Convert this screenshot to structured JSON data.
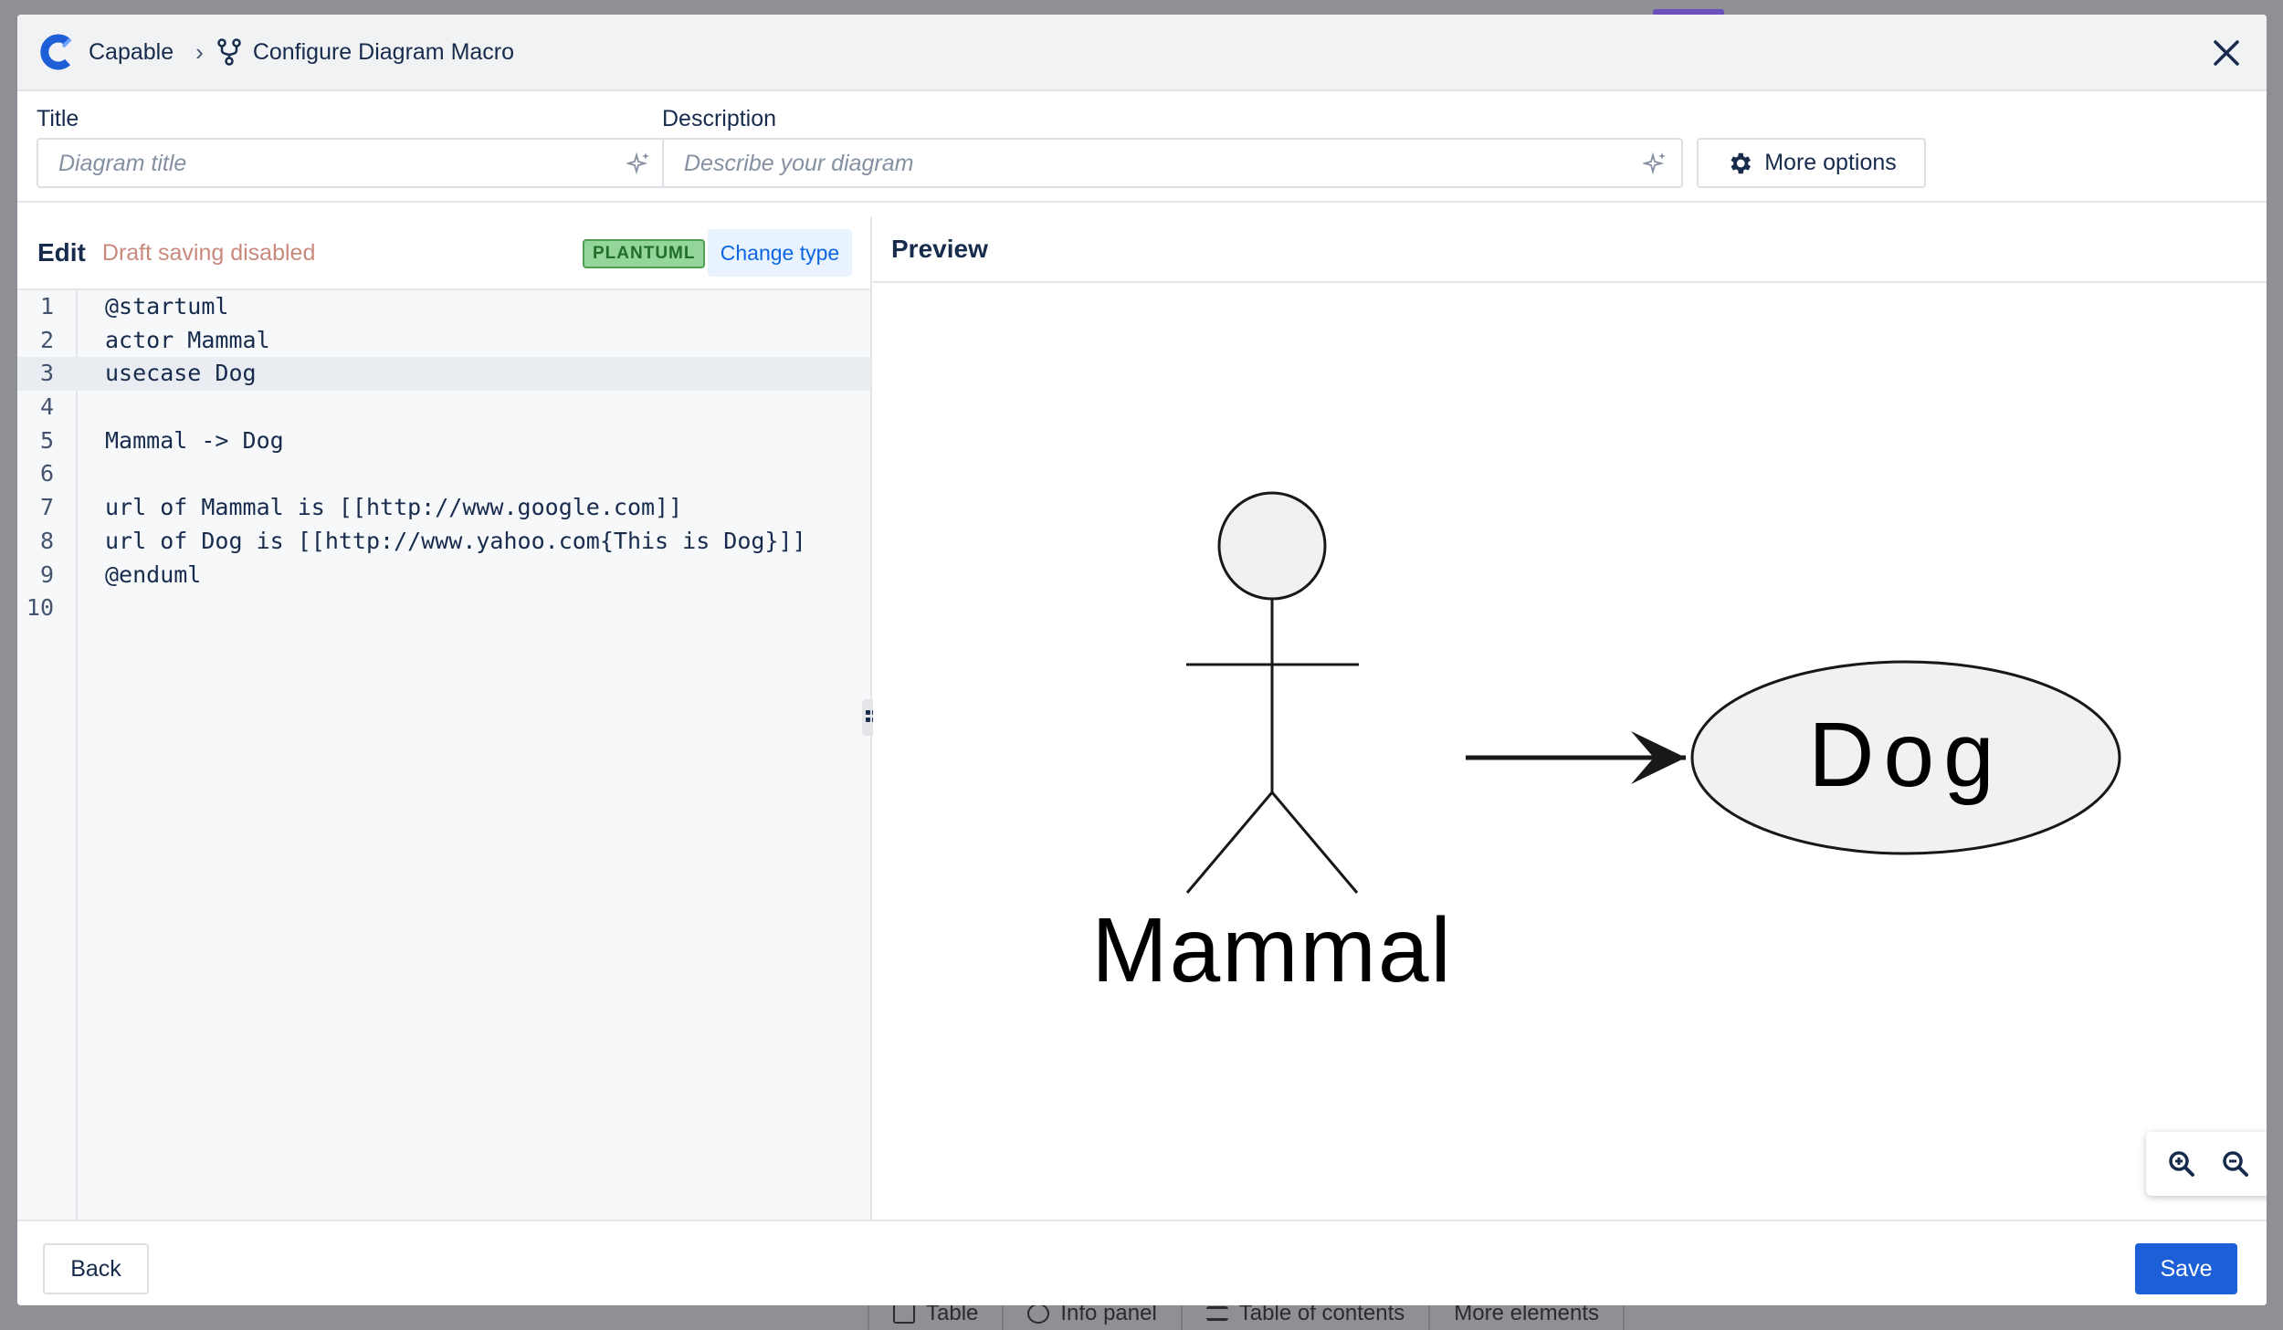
{
  "breadcrumb": {
    "app_name": "Capable",
    "current_page": "Configure Diagram Macro"
  },
  "fields": {
    "title_label": "Title",
    "title_placeholder": "Diagram title",
    "description_label": "Description",
    "description_placeholder": "Describe your diagram",
    "more_options_label": "More options"
  },
  "editor": {
    "heading": "Edit",
    "draft_status": "Draft saving disabled",
    "type_badge": "PLANTUML",
    "change_type_label": "Change type",
    "lines": [
      {
        "n": "1",
        "text": "@startuml"
      },
      {
        "n": "2",
        "text": "actor Mammal"
      },
      {
        "n": "3",
        "text": "usecase Dog"
      },
      {
        "n": "4",
        "text": ""
      },
      {
        "n": "5",
        "text": "Mammal -> Dog"
      },
      {
        "n": "6",
        "text": ""
      },
      {
        "n": "7",
        "text": "url of Mammal is [[http://www.google.com]]"
      },
      {
        "n": "8",
        "text": "url of Dog is [[http://www.yahoo.com{This is Dog}]]"
      },
      {
        "n": "9",
        "text": "@enduml"
      },
      {
        "n": "10",
        "text": ""
      }
    ],
    "active_line": 3
  },
  "preview": {
    "heading": "Preview",
    "actor_label": "Mammal",
    "usecase_label": "Dog"
  },
  "footer": {
    "back_label": "Back",
    "save_label": "Save"
  },
  "background": {
    "bottom_toolbar": [
      "Table",
      "Info panel",
      "Table of contents",
      "More elements"
    ]
  },
  "colors": {
    "accent": "#1d5fd6",
    "badge_bg": "#94d59a",
    "draft_text": "#c9897d"
  }
}
